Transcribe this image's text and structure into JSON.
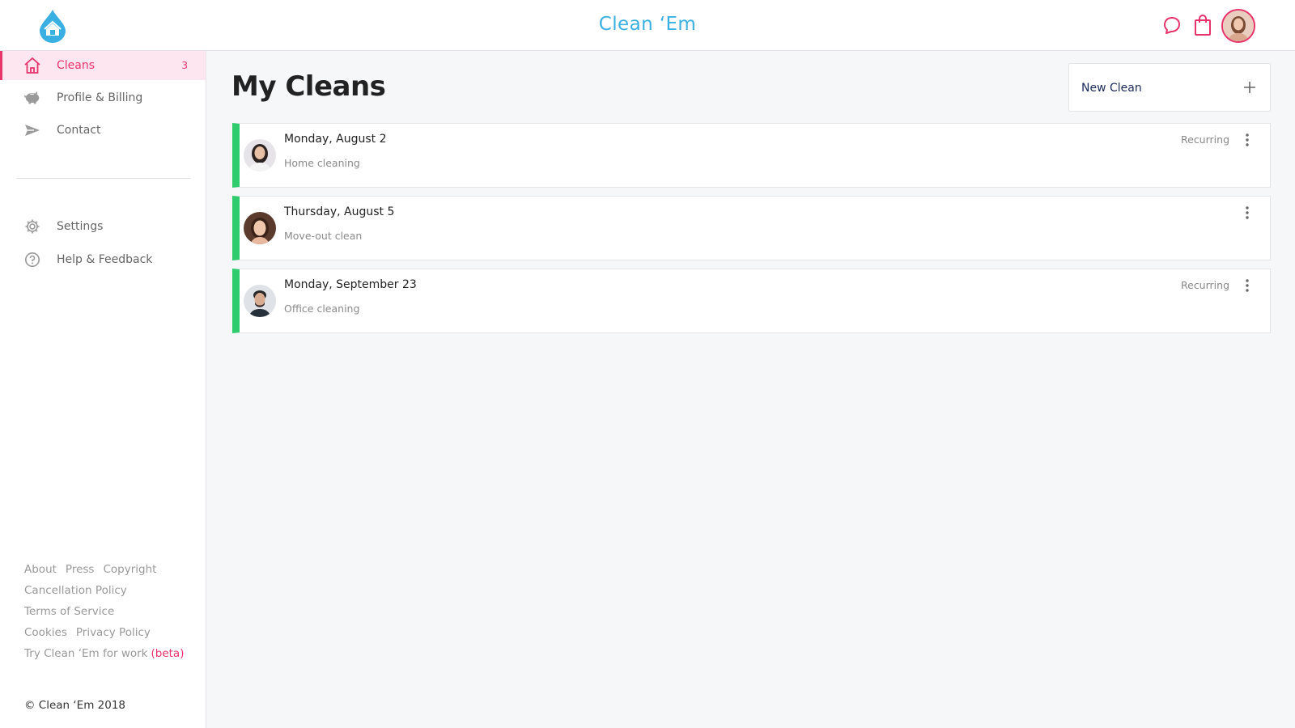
{
  "app": {
    "title": "Clean ‘Em",
    "brand_color": "#3ab0e2",
    "accent_color": "#e8336b",
    "status_color": "#2ecc6d"
  },
  "header": {
    "icons": [
      "house-drop-logo",
      "chat-bubble-icon",
      "shopping-bag-icon",
      "user-avatar"
    ]
  },
  "sidebar": {
    "items": [
      {
        "label": "Cleans",
        "icon": "home-icon",
        "badge": "3",
        "active": true
      },
      {
        "label": "Profile & Billing",
        "icon": "piggy-bank-icon"
      },
      {
        "label": "Contact",
        "icon": "send-icon"
      },
      {
        "label": "Settings",
        "icon": "gear-icon"
      },
      {
        "label": "Help & Feedback",
        "icon": "help-circle-icon"
      }
    ],
    "footer": {
      "about": "About",
      "press": "Press",
      "copyright_link": "Copyright",
      "cancellation": "Cancellation Policy",
      "terms": "Terms of Service",
      "cookies": "Cookies",
      "privacy": "Privacy Policy",
      "work": "Try Clean ‘Em for work",
      "beta": "(beta)",
      "copyright": "© Clean ‘Em 2018"
    }
  },
  "main": {
    "title": "My Cleans",
    "new_clean_label": "New Clean",
    "cleans": [
      {
        "date": "Monday, August 2",
        "type": "Home cleaning",
        "recurring": "Recurring"
      },
      {
        "date": "Thursday, August 5",
        "type": "Move-out clean",
        "recurring": ""
      },
      {
        "date": "Monday, September 23",
        "type": "Office cleaning",
        "recurring": "Recurring"
      }
    ]
  }
}
